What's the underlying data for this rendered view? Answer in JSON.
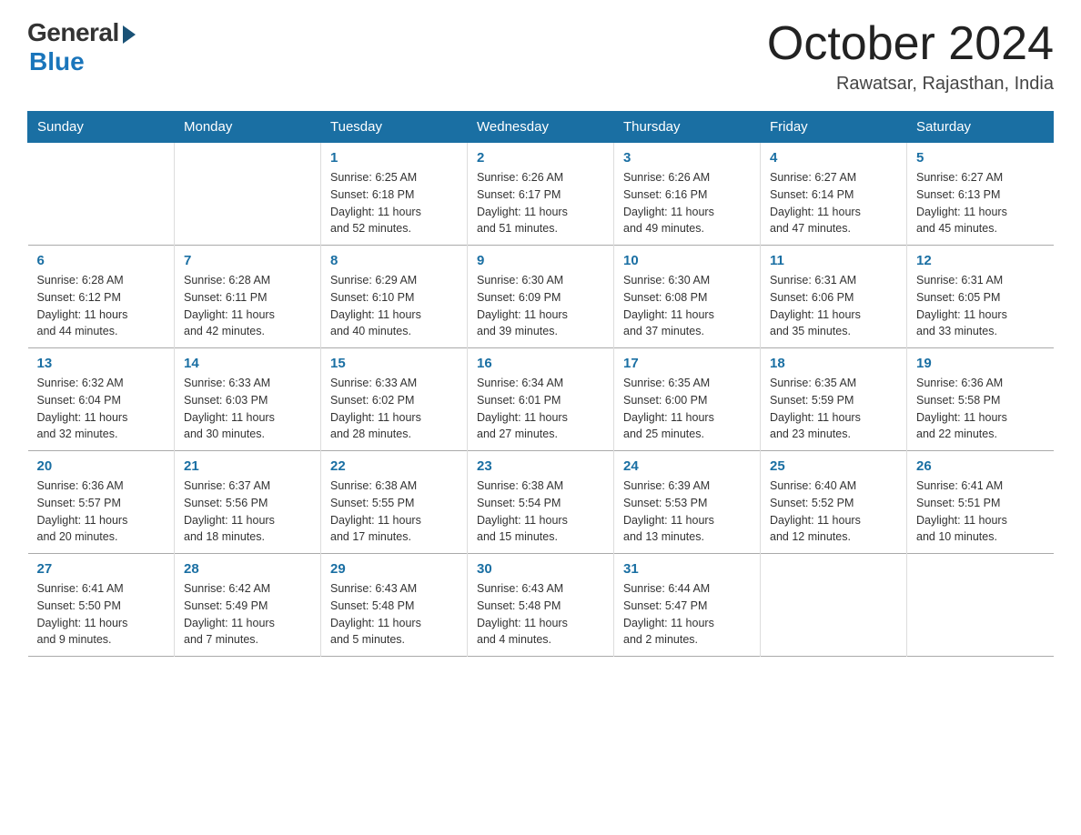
{
  "logo": {
    "general": "General",
    "blue": "Blue"
  },
  "title": "October 2024",
  "location": "Rawatsar, Rajasthan, India",
  "days_header": [
    "Sunday",
    "Monday",
    "Tuesday",
    "Wednesday",
    "Thursday",
    "Friday",
    "Saturday"
  ],
  "weeks": [
    [
      {
        "day": "",
        "info": ""
      },
      {
        "day": "",
        "info": ""
      },
      {
        "day": "1",
        "info": "Sunrise: 6:25 AM\nSunset: 6:18 PM\nDaylight: 11 hours\nand 52 minutes."
      },
      {
        "day": "2",
        "info": "Sunrise: 6:26 AM\nSunset: 6:17 PM\nDaylight: 11 hours\nand 51 minutes."
      },
      {
        "day": "3",
        "info": "Sunrise: 6:26 AM\nSunset: 6:16 PM\nDaylight: 11 hours\nand 49 minutes."
      },
      {
        "day": "4",
        "info": "Sunrise: 6:27 AM\nSunset: 6:14 PM\nDaylight: 11 hours\nand 47 minutes."
      },
      {
        "day": "5",
        "info": "Sunrise: 6:27 AM\nSunset: 6:13 PM\nDaylight: 11 hours\nand 45 minutes."
      }
    ],
    [
      {
        "day": "6",
        "info": "Sunrise: 6:28 AM\nSunset: 6:12 PM\nDaylight: 11 hours\nand 44 minutes."
      },
      {
        "day": "7",
        "info": "Sunrise: 6:28 AM\nSunset: 6:11 PM\nDaylight: 11 hours\nand 42 minutes."
      },
      {
        "day": "8",
        "info": "Sunrise: 6:29 AM\nSunset: 6:10 PM\nDaylight: 11 hours\nand 40 minutes."
      },
      {
        "day": "9",
        "info": "Sunrise: 6:30 AM\nSunset: 6:09 PM\nDaylight: 11 hours\nand 39 minutes."
      },
      {
        "day": "10",
        "info": "Sunrise: 6:30 AM\nSunset: 6:08 PM\nDaylight: 11 hours\nand 37 minutes."
      },
      {
        "day": "11",
        "info": "Sunrise: 6:31 AM\nSunset: 6:06 PM\nDaylight: 11 hours\nand 35 minutes."
      },
      {
        "day": "12",
        "info": "Sunrise: 6:31 AM\nSunset: 6:05 PM\nDaylight: 11 hours\nand 33 minutes."
      }
    ],
    [
      {
        "day": "13",
        "info": "Sunrise: 6:32 AM\nSunset: 6:04 PM\nDaylight: 11 hours\nand 32 minutes."
      },
      {
        "day": "14",
        "info": "Sunrise: 6:33 AM\nSunset: 6:03 PM\nDaylight: 11 hours\nand 30 minutes."
      },
      {
        "day": "15",
        "info": "Sunrise: 6:33 AM\nSunset: 6:02 PM\nDaylight: 11 hours\nand 28 minutes."
      },
      {
        "day": "16",
        "info": "Sunrise: 6:34 AM\nSunset: 6:01 PM\nDaylight: 11 hours\nand 27 minutes."
      },
      {
        "day": "17",
        "info": "Sunrise: 6:35 AM\nSunset: 6:00 PM\nDaylight: 11 hours\nand 25 minutes."
      },
      {
        "day": "18",
        "info": "Sunrise: 6:35 AM\nSunset: 5:59 PM\nDaylight: 11 hours\nand 23 minutes."
      },
      {
        "day": "19",
        "info": "Sunrise: 6:36 AM\nSunset: 5:58 PM\nDaylight: 11 hours\nand 22 minutes."
      }
    ],
    [
      {
        "day": "20",
        "info": "Sunrise: 6:36 AM\nSunset: 5:57 PM\nDaylight: 11 hours\nand 20 minutes."
      },
      {
        "day": "21",
        "info": "Sunrise: 6:37 AM\nSunset: 5:56 PM\nDaylight: 11 hours\nand 18 minutes."
      },
      {
        "day": "22",
        "info": "Sunrise: 6:38 AM\nSunset: 5:55 PM\nDaylight: 11 hours\nand 17 minutes."
      },
      {
        "day": "23",
        "info": "Sunrise: 6:38 AM\nSunset: 5:54 PM\nDaylight: 11 hours\nand 15 minutes."
      },
      {
        "day": "24",
        "info": "Sunrise: 6:39 AM\nSunset: 5:53 PM\nDaylight: 11 hours\nand 13 minutes."
      },
      {
        "day": "25",
        "info": "Sunrise: 6:40 AM\nSunset: 5:52 PM\nDaylight: 11 hours\nand 12 minutes."
      },
      {
        "day": "26",
        "info": "Sunrise: 6:41 AM\nSunset: 5:51 PM\nDaylight: 11 hours\nand 10 minutes."
      }
    ],
    [
      {
        "day": "27",
        "info": "Sunrise: 6:41 AM\nSunset: 5:50 PM\nDaylight: 11 hours\nand 9 minutes."
      },
      {
        "day": "28",
        "info": "Sunrise: 6:42 AM\nSunset: 5:49 PM\nDaylight: 11 hours\nand 7 minutes."
      },
      {
        "day": "29",
        "info": "Sunrise: 6:43 AM\nSunset: 5:48 PM\nDaylight: 11 hours\nand 5 minutes."
      },
      {
        "day": "30",
        "info": "Sunrise: 6:43 AM\nSunset: 5:48 PM\nDaylight: 11 hours\nand 4 minutes."
      },
      {
        "day": "31",
        "info": "Sunrise: 6:44 AM\nSunset: 5:47 PM\nDaylight: 11 hours\nand 2 minutes."
      },
      {
        "day": "",
        "info": ""
      },
      {
        "day": "",
        "info": ""
      }
    ]
  ]
}
